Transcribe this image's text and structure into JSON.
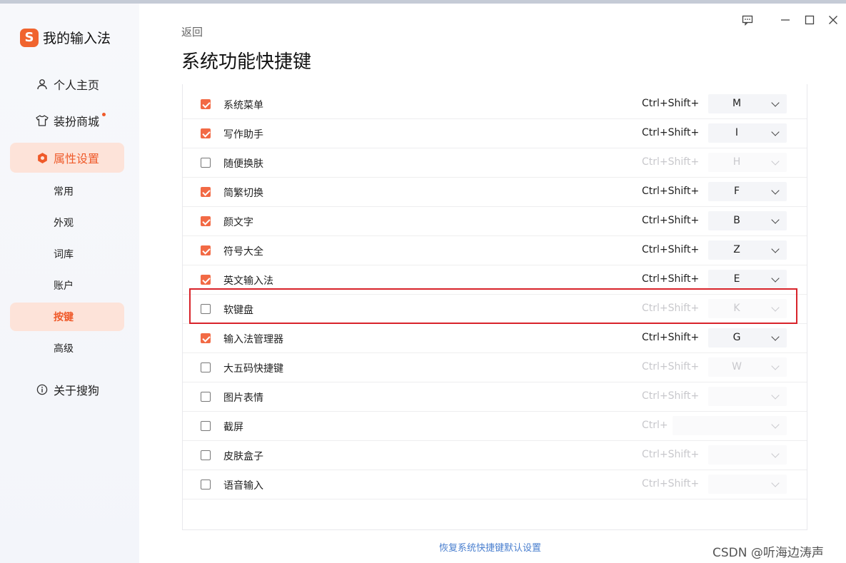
{
  "app": {
    "title": "我的输入法",
    "logo_glyph": "S"
  },
  "sidebar": {
    "items": [
      {
        "label": "个人主页",
        "icon": "person-icon"
      },
      {
        "label": "装扮商城",
        "icon": "shirt-icon",
        "badge": true
      },
      {
        "label": "属性设置",
        "icon": "hexagon-icon",
        "active": true
      },
      {
        "label": "关于搜狗",
        "icon": "info-icon"
      }
    ],
    "sub_items": [
      "常用",
      "外观",
      "词库",
      "账户",
      "按键",
      "高级"
    ],
    "active_sub": "按键"
  },
  "header": {
    "back_label": "返回",
    "title": "系统功能快捷键"
  },
  "shortcuts": [
    {
      "label": "系统菜单",
      "checked": true,
      "prefix": "Ctrl+Shift+",
      "key": "M"
    },
    {
      "label": "写作助手",
      "checked": true,
      "prefix": "Ctrl+Shift+",
      "key": "I"
    },
    {
      "label": "随便换肤",
      "checked": false,
      "prefix": "Ctrl+Shift+",
      "key": "H"
    },
    {
      "label": "简繁切换",
      "checked": true,
      "prefix": "Ctrl+Shift+",
      "key": "F"
    },
    {
      "label": "颜文字",
      "checked": true,
      "prefix": "Ctrl+Shift+",
      "key": "B"
    },
    {
      "label": "符号大全",
      "checked": true,
      "prefix": "Ctrl+Shift+",
      "key": "Z"
    },
    {
      "label": "英文输入法",
      "checked": true,
      "prefix": "Ctrl+Shift+",
      "key": "E"
    },
    {
      "label": "软键盘",
      "checked": false,
      "prefix": "Ctrl+Shift+",
      "key": "K",
      "highlighted": true
    },
    {
      "label": "输入法管理器",
      "checked": true,
      "prefix": "Ctrl+Shift+",
      "key": "G"
    },
    {
      "label": "大五码快捷键",
      "checked": false,
      "prefix": "Ctrl+Shift+",
      "key": "W"
    },
    {
      "label": "图片表情",
      "checked": false,
      "prefix": "Ctrl+Shift+",
      "key": ""
    },
    {
      "label": "截屏",
      "checked": false,
      "prefix": "Ctrl+",
      "key": ""
    },
    {
      "label": "皮肤盒子",
      "checked": false,
      "prefix": "Ctrl+Shift+",
      "key": ""
    },
    {
      "label": "语音输入",
      "checked": false,
      "prefix": "Ctrl+Shift+",
      "key": ""
    }
  ],
  "footer": {
    "restore_label": "恢复系统快捷键默认设置"
  },
  "watermark": "CSDN @听海边涛声",
  "colors": {
    "accent": "#ef5a2a",
    "active_bg": "#fde3d9",
    "link": "#4a7fcf",
    "highlight_box": "#d8232a"
  }
}
